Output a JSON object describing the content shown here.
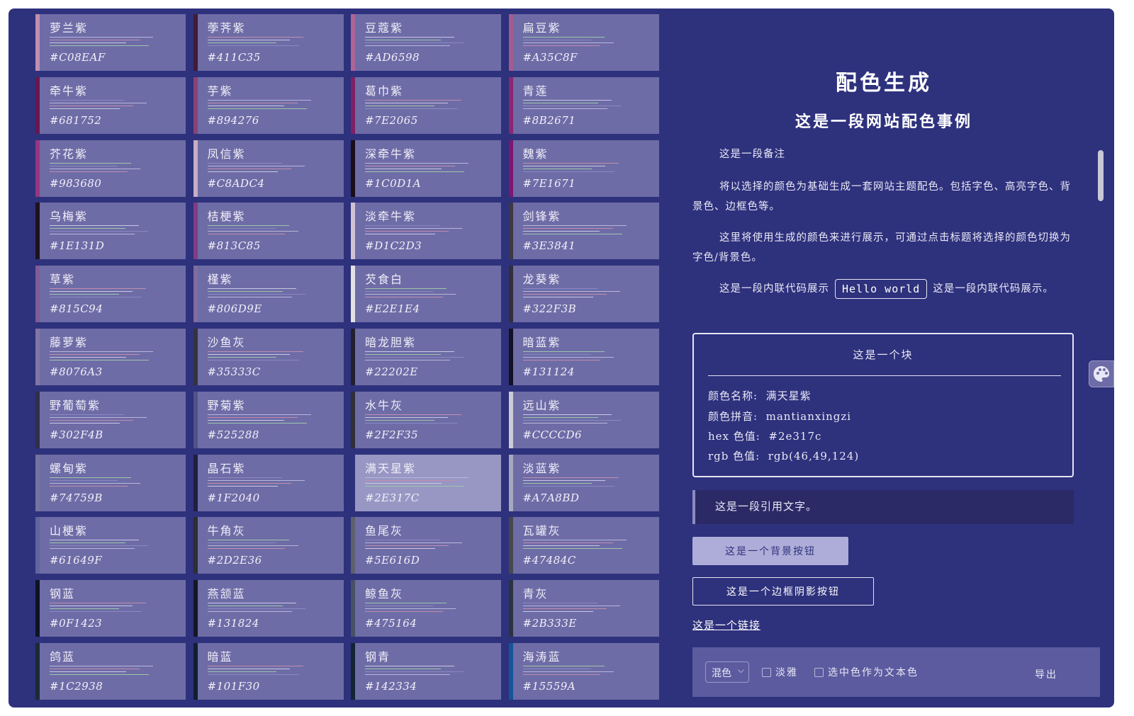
{
  "colors": [
    {
      "name": "萝兰紫",
      "hex": "#C08EAF",
      "color": "#c08eaf"
    },
    {
      "name": "荸荠紫",
      "hex": "#411C35",
      "color": "#411c35"
    },
    {
      "name": "豆蔻紫",
      "hex": "#AD6598",
      "color": "#ad6598"
    },
    {
      "name": "扁豆紫",
      "hex": "#A35C8F",
      "color": "#a35c8f"
    },
    {
      "name": "牵牛紫",
      "hex": "#681752",
      "color": "#681752"
    },
    {
      "name": "芋紫",
      "hex": "#894276",
      "color": "#894276"
    },
    {
      "name": "葛巾紫",
      "hex": "#7E2065",
      "color": "#7e2065"
    },
    {
      "name": "青莲",
      "hex": "#8B2671",
      "color": "#8b2671"
    },
    {
      "name": "芥花紫",
      "hex": "#983680",
      "color": "#983680"
    },
    {
      "name": "凤信紫",
      "hex": "#C8ADC4",
      "color": "#c8adc4"
    },
    {
      "name": "深牵牛紫",
      "hex": "#1C0D1A",
      "color": "#1c0d1a"
    },
    {
      "name": "魏紫",
      "hex": "#7E1671",
      "color": "#7e1671"
    },
    {
      "name": "乌梅紫",
      "hex": "#1E131D",
      "color": "#1e131d"
    },
    {
      "name": "桔梗紫",
      "hex": "#813C85",
      "color": "#813c85"
    },
    {
      "name": "淡牵牛紫",
      "hex": "#D1C2D3",
      "color": "#d1c2d3"
    },
    {
      "name": "剑锋紫",
      "hex": "#3E3841",
      "color": "#3e3841"
    },
    {
      "name": "草紫",
      "hex": "#815C94",
      "color": "#815c94"
    },
    {
      "name": "槿紫",
      "hex": "#806D9E",
      "color": "#806d9e"
    },
    {
      "name": "芡食白",
      "hex": "#E2E1E4",
      "color": "#e2e1e4"
    },
    {
      "name": "龙葵紫",
      "hex": "#322F3B",
      "color": "#322f3b"
    },
    {
      "name": "藤萝紫",
      "hex": "#8076A3",
      "color": "#8076a3"
    },
    {
      "name": "沙鱼灰",
      "hex": "#35333C",
      "color": "#35333c"
    },
    {
      "name": "暗龙胆紫",
      "hex": "#22202E",
      "color": "#22202e"
    },
    {
      "name": "暗蓝紫",
      "hex": "#131124",
      "color": "#131124"
    },
    {
      "name": "野葡萄紫",
      "hex": "#302F4B",
      "color": "#302f4b"
    },
    {
      "name": "野菊紫",
      "hex": "#525288",
      "color": "#525288"
    },
    {
      "name": "水牛灰",
      "hex": "#2F2F35",
      "color": "#2f2f35"
    },
    {
      "name": "远山紫",
      "hex": "#CCCCD6",
      "color": "#ccccd6"
    },
    {
      "name": "螺甸紫",
      "hex": "#74759B",
      "color": "#74759b"
    },
    {
      "name": "晶石紫",
      "hex": "#1F2040",
      "color": "#1f2040"
    },
    {
      "name": "满天星紫",
      "hex": "#2E317C",
      "color": "#2e317c",
      "selected": true
    },
    {
      "name": "淡蓝紫",
      "hex": "#A7A8BD",
      "color": "#a7a8bd"
    },
    {
      "name": "山梗紫",
      "hex": "#61649F",
      "color": "#61649f"
    },
    {
      "name": "牛角灰",
      "hex": "#2D2E36",
      "color": "#2d2e36"
    },
    {
      "name": "鱼尾灰",
      "hex": "#5E616D",
      "color": "#5e616d"
    },
    {
      "name": "瓦罐灰",
      "hex": "#47484C",
      "color": "#47484c"
    },
    {
      "name": "钢蓝",
      "hex": "#0F1423",
      "color": "#0f1423"
    },
    {
      "name": "燕颔蓝",
      "hex": "#131824",
      "color": "#131824"
    },
    {
      "name": "鲸鱼灰",
      "hex": "#475164",
      "color": "#475164"
    },
    {
      "name": "青灰",
      "hex": "#2B333E",
      "color": "#2b333e"
    },
    {
      "name": "鸽蓝",
      "hex": "#1C2938",
      "color": "#1c2938"
    },
    {
      "name": "暗蓝",
      "hex": "#101F30",
      "color": "#101f30"
    },
    {
      "name": "钢青",
      "hex": "#142334",
      "color": "#142334"
    },
    {
      "name": "海涛蓝",
      "hex": "#15559A",
      "color": "#15559a"
    }
  ],
  "panel": {
    "title": "配色生成",
    "subtitle": "这是一段网站配色事例",
    "note": "这是一段备注",
    "para1": "将以选择的颜色为基础生成一套网站主题配色。包括字色、高亮字色、背景色、边框色等。",
    "para2": "这里将使用生成的颜色来进行展示，可通过点击标题将选择的颜色切换为字色/背景色。",
    "para3_before": "这是一段内联代码展示",
    "code": "Hello world",
    "para3_after": "这是一段内联代码展示。",
    "block": {
      "title": "这是一个块",
      "name_label": "颜色名称:",
      "name_value": "满天星紫",
      "pinyin_label": "颜色拼音:",
      "pinyin_value": "mantianxingzi",
      "hex_label": "hex 色值:",
      "hex_value": "#2e317c",
      "rgb_label": "rgb 色值:",
      "rgb_value": "rgb(46,49,124)"
    },
    "quote": "这是一段引用文字。",
    "bg_button": "这是一个背景按钮",
    "border_button": "这是一个边框阴影按钮",
    "link": "这是一个链接"
  },
  "toolbar": {
    "mode_select": "混色",
    "checkbox1": "淡雅",
    "checkbox2": "选中色作为文本色",
    "export": "导出"
  },
  "icons": {
    "palette": "palette-icon",
    "chevron": "chevron-down-icon"
  }
}
